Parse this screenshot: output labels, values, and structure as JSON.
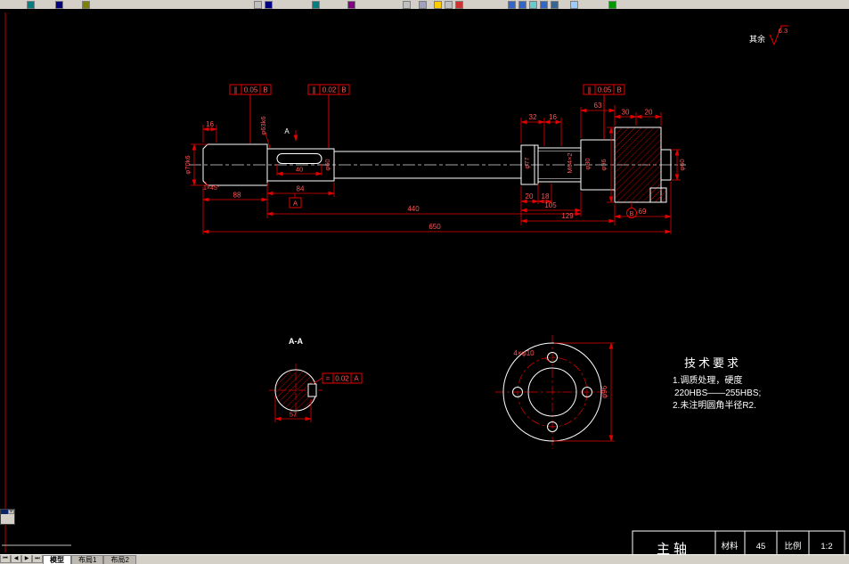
{
  "toolbar": {
    "icons": [
      "new-icon",
      "open-icon",
      "save-icon",
      "undo-icon",
      "redo-icon",
      "pan-icon",
      "zoom-icon",
      "layers-icon",
      "properties-icon",
      "lock-icon",
      "grid-icon",
      "osnap-icon",
      "line-icon",
      "polyline-icon",
      "circle-icon",
      "arc-icon",
      "rectangle-icon",
      "hatch-icon",
      "dimension-icon"
    ]
  },
  "surface_note": {
    "label": "其余",
    "value": "6.3"
  },
  "frames": [
    {
      "symbol": "∥",
      "value": "0.05",
      "datum": "B"
    },
    {
      "symbol": "∥",
      "value": "0.02",
      "datum": "B"
    },
    {
      "symbol": "∥",
      "value": "0.05",
      "datum": "B"
    }
  ],
  "dims": {
    "chamfer": "1×45°",
    "left_len": "88",
    "key_len": "40",
    "key_total": "84",
    "groove1": "20",
    "groove2": "18",
    "seg105": "105",
    "seg129": "129",
    "body440": "440",
    "total650": "650",
    "right69": "69",
    "top16": "16",
    "top32": "32",
    "top16b": "16",
    "top63": "63",
    "top30": "30",
    "top20": "20",
    "dia_left": "φ70k6",
    "dia_key": "φ63k6",
    "dia_mid": "φ60",
    "dia_collar": "φ77",
    "thread": "M64×2",
    "dia_pre": "φ80",
    "dia_flange": "φ96",
    "dia_stub": "φ60"
  },
  "datums": {
    "a": "A",
    "b": "B",
    "cut": "A"
  },
  "section_view": {
    "title": "A-A",
    "tol_symbol": "=",
    "tol_value": "0.02",
    "tol_datum": "A",
    "width57": "57"
  },
  "flange_view": {
    "holes": "4×φ10",
    "outer_dia": "φ96"
  },
  "tech_req": {
    "title": "技术要求",
    "line1": "1.调质处理，硬度",
    "line2": "220HBS——255HBS;",
    "line3": "2.未注明圆角半径R2."
  },
  "title_block": {
    "part": "主轴",
    "material_label": "材料",
    "material": "45",
    "scale_label": "比例",
    "scale": "1:2"
  },
  "tabs": {
    "prev_all": "⏮",
    "prev": "◀",
    "next": "▶",
    "next_all": "⏭",
    "model": "模型",
    "layout1": "布局1",
    "layout2": "布局2"
  },
  "misc": {
    "close_glyph": "×"
  }
}
